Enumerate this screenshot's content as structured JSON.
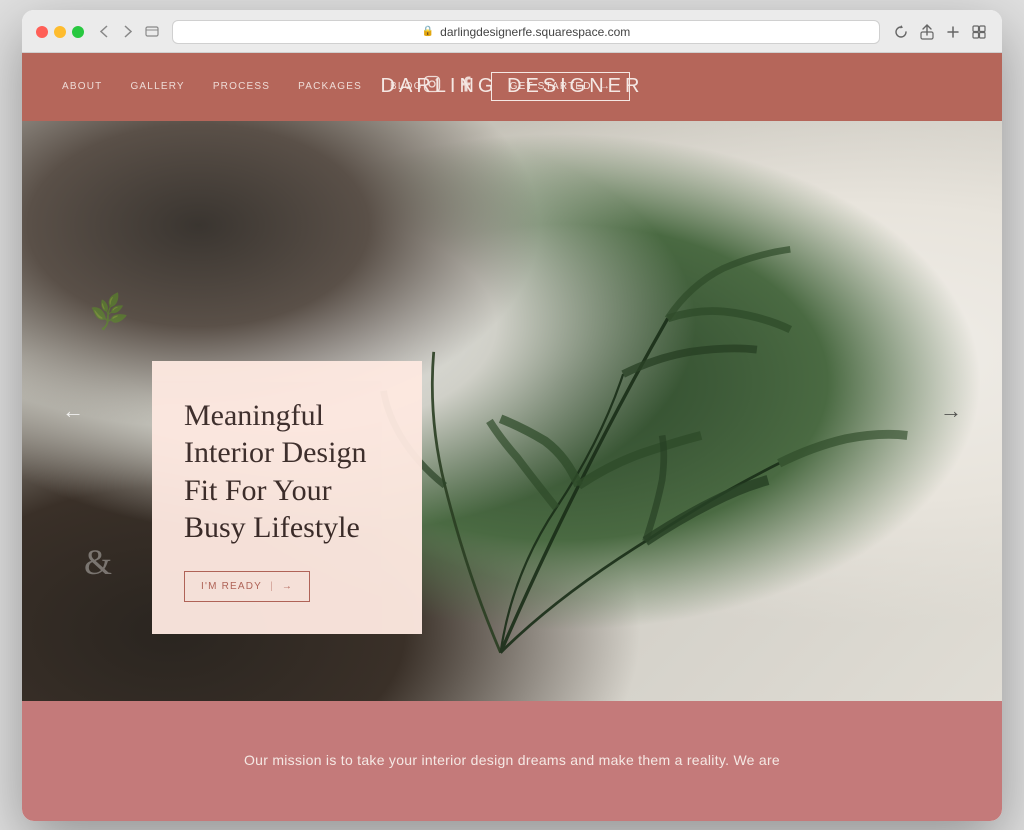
{
  "browser": {
    "url": "darlingdesignerfe.squarespace.com",
    "back_arrow": "←",
    "forward_arrow": "→",
    "reload": "↻",
    "share": "⎋",
    "new_tab": "+",
    "tabs": "⧉"
  },
  "nav": {
    "items": [
      {
        "label": "ABOUT",
        "id": "about"
      },
      {
        "label": "GALLERY",
        "id": "gallery"
      },
      {
        "label": "PROCESS",
        "id": "process"
      },
      {
        "label": "PACKAGES",
        "id": "packages"
      },
      {
        "label": "BLOG",
        "id": "blog"
      }
    ],
    "logo": "DARLING DESIGNER",
    "get_started": "GET STARTED",
    "get_started_arrow": "→"
  },
  "hero": {
    "heading_line1": "Meaningful",
    "heading_line2": "Interior Design",
    "heading_line3": "Fit For Your",
    "heading_line4": "Busy Lifestyle",
    "cta_label": "I'M READY",
    "cta_arrow": "→",
    "prev_arrow": "←",
    "next_arrow": "→"
  },
  "mission": {
    "text": "Our mission is to take your interior design dreams and make them a reality. We are"
  }
}
